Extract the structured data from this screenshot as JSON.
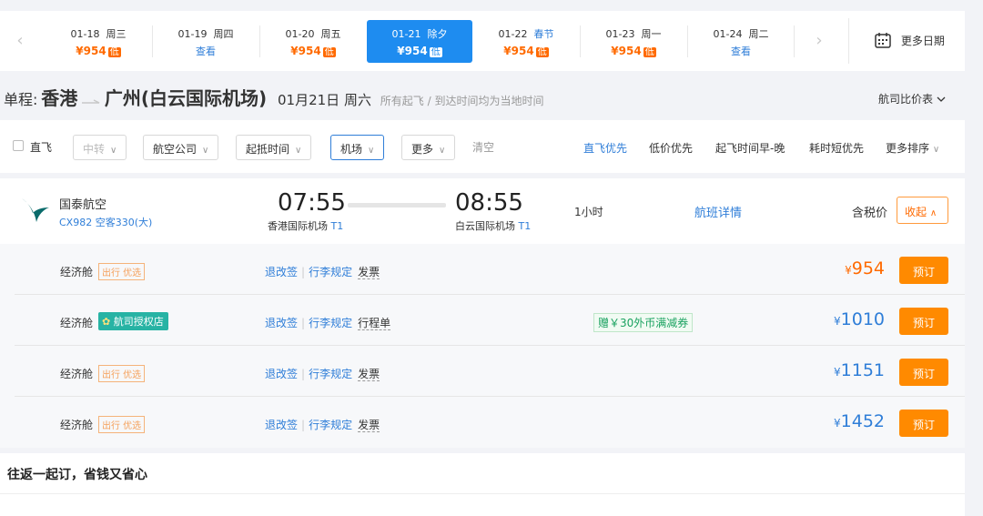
{
  "datebar": {
    "prev": "‹",
    "next": "›",
    "dates": [
      {
        "date": "01-18",
        "day": "周三",
        "price": "¥954",
        "tag": "低",
        "holiday": "",
        "active": false
      },
      {
        "date": "01-19",
        "day": "周四",
        "price": "查看",
        "tag": "",
        "holiday": "",
        "active": false
      },
      {
        "date": "01-20",
        "day": "周五",
        "price": "¥954",
        "tag": "低",
        "holiday": "",
        "active": false
      },
      {
        "date": "01-21",
        "day": "除夕",
        "price": "¥954",
        "tag": "低",
        "holiday": "",
        "active": true
      },
      {
        "date": "01-22",
        "day": "",
        "price": "¥954",
        "tag": "低",
        "holiday": "春节",
        "active": false
      },
      {
        "date": "01-23",
        "day": "周一",
        "price": "¥954",
        "tag": "低",
        "holiday": "",
        "active": false
      },
      {
        "date": "01-24",
        "day": "周二",
        "price": "查看",
        "tag": "",
        "holiday": "",
        "active": false
      }
    ],
    "more_dates": "更多日期"
  },
  "route": {
    "label": "单程:",
    "from": "香港",
    "to": "广州(白云国际机场)",
    "date": "01月21日 周六",
    "note": "所有起飞 / 到达时间均为当地时间",
    "compare": "航司比价表"
  },
  "filters": {
    "direct": "直飞",
    "transfer": "中转",
    "airline": "航空公司",
    "time": "起抵时间",
    "airport": "机场",
    "more": "更多",
    "clear": "清空",
    "sorts": [
      "直飞优先",
      "低价优先",
      "起飞时间早-晚",
      "耗时短优先",
      "更多排序"
    ]
  },
  "flight": {
    "airline": "国泰航空",
    "flight_no": "CX982 空客330(大)",
    "dep_time": "07:55",
    "dep_airport": "香港国际机场",
    "dep_terminal": "T1",
    "arr_time": "08:55",
    "arr_airport": "白云国际机场",
    "arr_terminal": "T1",
    "duration": "1小时",
    "details": "航班详情",
    "tax_included": "含税价",
    "collapse": "收起"
  },
  "fares": [
    {
      "cabin": "经济舱",
      "tag": "出行 优选",
      "tag_type": "outline",
      "link1": "退改签",
      "link2": "行李规定",
      "doc": "发票",
      "coupon": "",
      "price": "954",
      "price_color": "orange",
      "book": "预订"
    },
    {
      "cabin": "经济舱",
      "tag": "航司授权店",
      "tag_type": "green",
      "link1": "退改签",
      "link2": "行李规定",
      "doc": "行程单",
      "coupon": "赠￥30外币满减券",
      "price": "1010",
      "price_color": "blue",
      "book": "预订"
    },
    {
      "cabin": "经济舱",
      "tag": "出行 优选",
      "tag_type": "outline",
      "link1": "退改签",
      "link2": "行李规定",
      "doc": "发票",
      "coupon": "",
      "price": "1151",
      "price_color": "blue",
      "book": "预订"
    },
    {
      "cabin": "经济舱",
      "tag": "出行 优选",
      "tag_type": "outline",
      "link1": "退改签",
      "link2": "行李规定",
      "doc": "发票",
      "coupon": "",
      "price": "1452",
      "price_color": "blue",
      "book": "预订"
    }
  ],
  "currency": "¥",
  "roundtrip": {
    "title": "往返一起订，省钱又省心"
  },
  "colors": {
    "accent_blue": "#1e8cf0",
    "price_orange": "#ff6a00",
    "book_button": "#ff8a00",
    "link_blue": "#2f7ed8"
  },
  "icons": {
    "calendar": "calendar-icon",
    "chevron": "chevron-down-icon",
    "logo": "cathay-logo"
  }
}
